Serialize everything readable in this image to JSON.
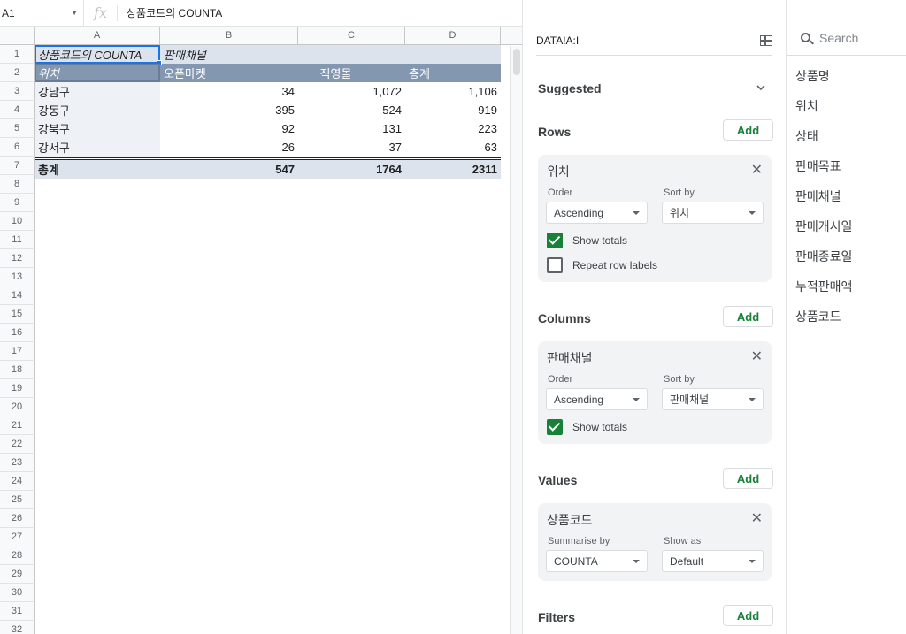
{
  "formula_bar": {
    "cell_ref": "A1",
    "fx": "fx",
    "value": "상품코드의 COUNTA"
  },
  "grid": {
    "columns": [
      "A",
      "B",
      "C",
      "D"
    ],
    "rows": [
      "1",
      "2",
      "3",
      "4",
      "5",
      "6",
      "7",
      "8",
      "9",
      "10",
      "11",
      "12",
      "13",
      "14",
      "15",
      "16",
      "17",
      "18",
      "19",
      "20",
      "21",
      "22",
      "23",
      "24",
      "25",
      "26",
      "27",
      "28",
      "29",
      "30",
      "31",
      "32"
    ],
    "header1": {
      "a": "상품코드의 COUNTA",
      "b": "판매채널"
    },
    "header2": {
      "a": "위치",
      "b": "오픈마켓",
      "c": "직영몰",
      "d": "총계"
    },
    "data": [
      {
        "loc": "강남구",
        "b": "34",
        "c": "1,072",
        "d": "1,106"
      },
      {
        "loc": "강동구",
        "b": "395",
        "c": "524",
        "d": "919"
      },
      {
        "loc": "강북구",
        "b": "92",
        "c": "131",
        "d": "223"
      },
      {
        "loc": "강서구",
        "b": "26",
        "c": "37",
        "d": "63"
      }
    ],
    "total": {
      "label": "총계",
      "b": "547",
      "c": "1764",
      "d": "2311"
    }
  },
  "editor": {
    "range": "DATA!A:I",
    "suggested": "Suggested",
    "rows": {
      "title": "Rows",
      "add": "Add",
      "field": "위치",
      "order_label": "Order",
      "order": "Ascending",
      "sortby_label": "Sort by",
      "sortby": "위치",
      "show_totals": "Show totals",
      "repeat": "Repeat row labels"
    },
    "columns": {
      "title": "Columns",
      "add": "Add",
      "field": "판매채널",
      "order_label": "Order",
      "order": "Ascending",
      "sortby_label": "Sort by",
      "sortby": "판매채널",
      "show_totals": "Show totals"
    },
    "values": {
      "title": "Values",
      "add": "Add",
      "field": "상품코드",
      "summarise_label": "Summarise by",
      "summarise": "COUNTA",
      "showas_label": "Show as",
      "showas": "Default"
    },
    "filters": {
      "title": "Filters",
      "add": "Add"
    }
  },
  "fields": {
    "search_placeholder": "Search",
    "items": [
      "상품명",
      "위치",
      "상태",
      "판매목표",
      "판매채널",
      "판매개시일",
      "판매종료일",
      "누적판매액",
      "상품코드"
    ]
  },
  "colors": {
    "accent": "#188038",
    "pivot_header": "#8497b0",
    "pivot_light": "#dde3ec"
  }
}
